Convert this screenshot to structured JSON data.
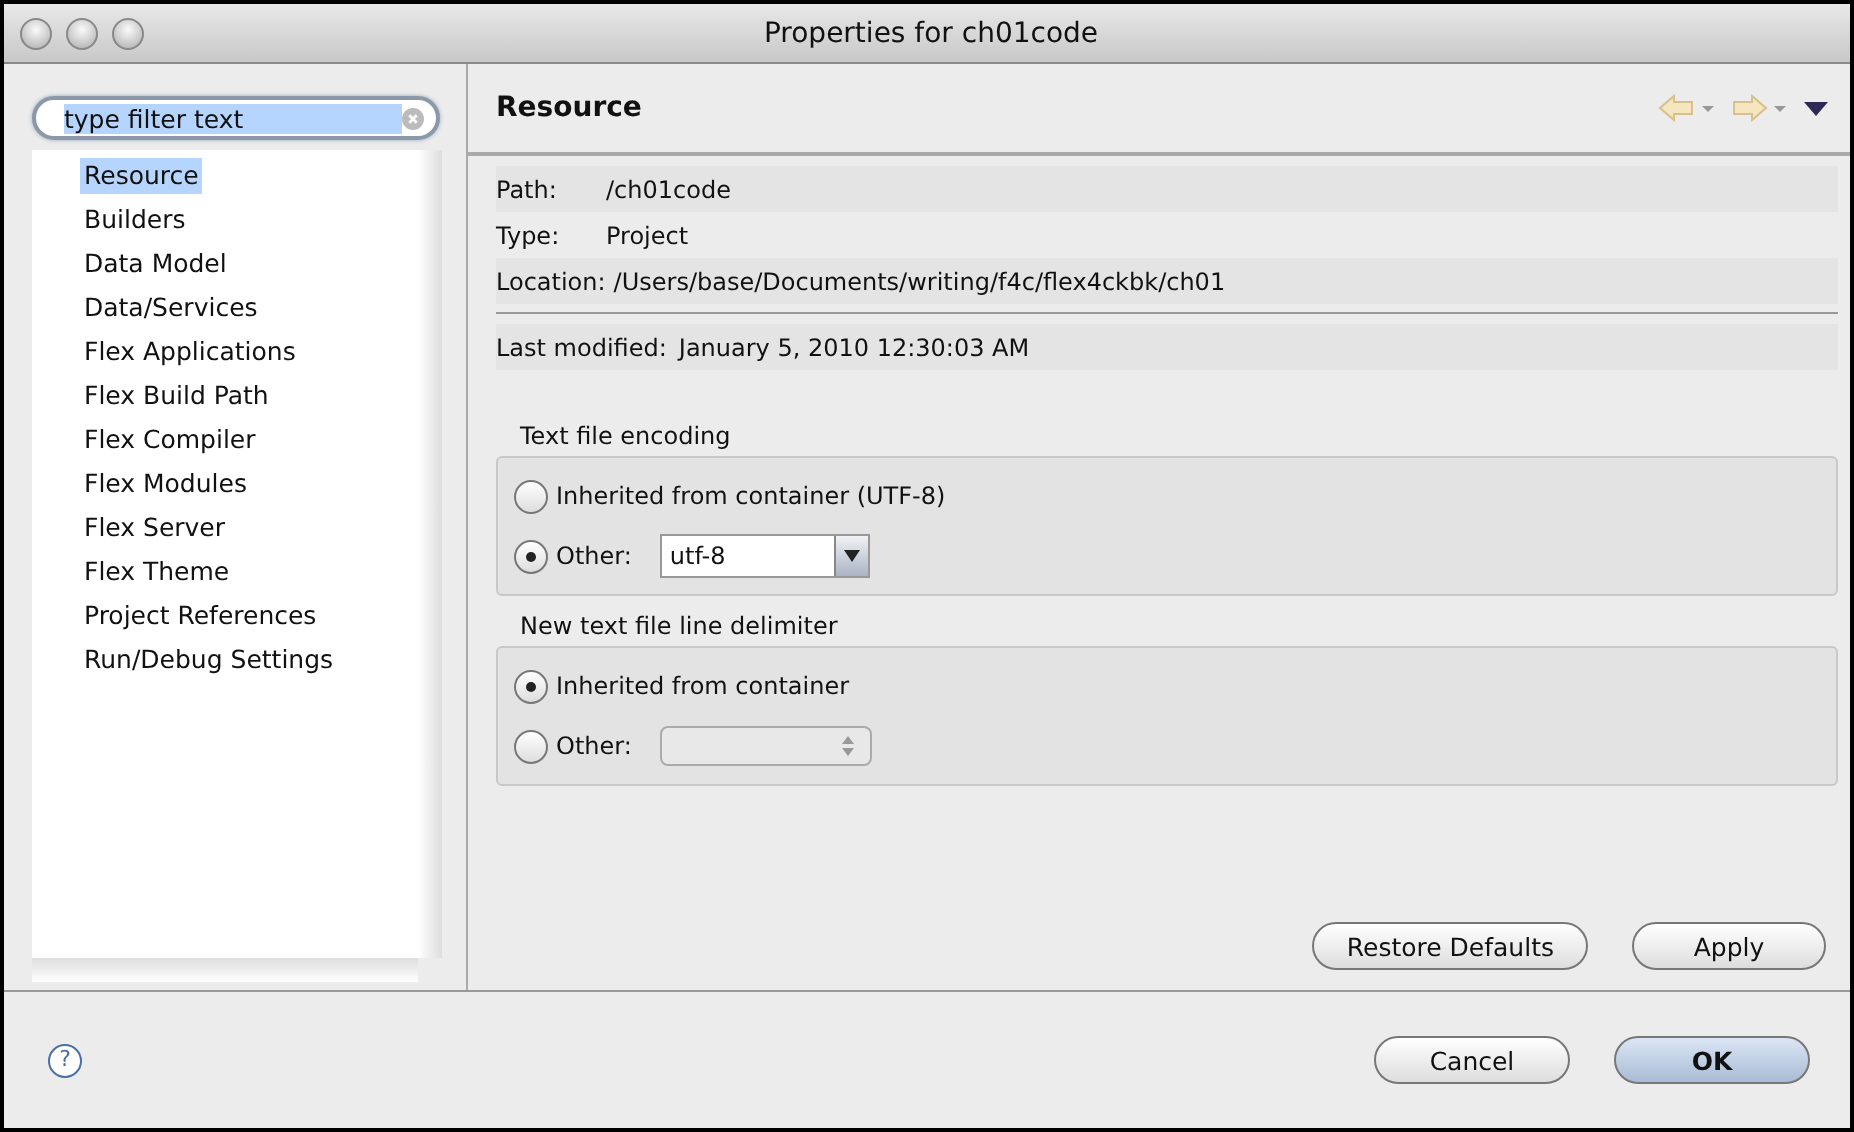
{
  "window": {
    "title": "Properties for ch01code"
  },
  "filter": {
    "value": "type filter text",
    "text_selected": true
  },
  "sidebar": {
    "items": [
      {
        "label": "Resource",
        "selected": true
      },
      {
        "label": "Builders",
        "selected": false
      },
      {
        "label": "Data Model",
        "selected": false
      },
      {
        "label": "Data/Services",
        "selected": false
      },
      {
        "label": "Flex Applications",
        "selected": false
      },
      {
        "label": "Flex Build Path",
        "selected": false
      },
      {
        "label": "Flex Compiler",
        "selected": false
      },
      {
        "label": "Flex Modules",
        "selected": false
      },
      {
        "label": "Flex Server",
        "selected": false
      },
      {
        "label": "Flex Theme",
        "selected": false
      },
      {
        "label": "Project References",
        "selected": false
      },
      {
        "label": "Run/Debug Settings",
        "selected": false
      }
    ]
  },
  "page": {
    "title": "Resource",
    "info": [
      {
        "label": "Path:",
        "value": "/ch01code"
      },
      {
        "label": "Type:",
        "value": "Project"
      },
      {
        "label": "Location:",
        "value": "/Users/base/Documents/writing/f4c/flex4ckbk/ch01"
      }
    ],
    "modified": {
      "label": "Last modified:",
      "value": "January 5, 2010 12:30:03 AM"
    },
    "groups": [
      {
        "title": "Text file encoding",
        "options": [
          {
            "label": "Inherited from container (UTF-8)",
            "selected": false
          },
          {
            "label": "Other:",
            "selected": true,
            "field": {
              "kind": "combo",
              "value": "utf-8",
              "disabled": false
            }
          }
        ]
      },
      {
        "title": "New text file line delimiter",
        "options": [
          {
            "label": "Inherited from container",
            "selected": true
          },
          {
            "label": "Other:",
            "selected": false,
            "field": {
              "kind": "spinner",
              "disabled": true
            }
          }
        ]
      }
    ],
    "buttons": [
      "Restore Defaults",
      "Apply"
    ]
  },
  "footer": {
    "help": "?",
    "buttons": [
      {
        "label": "Cancel",
        "default": false
      },
      {
        "label": "OK",
        "default": true
      }
    ]
  }
}
